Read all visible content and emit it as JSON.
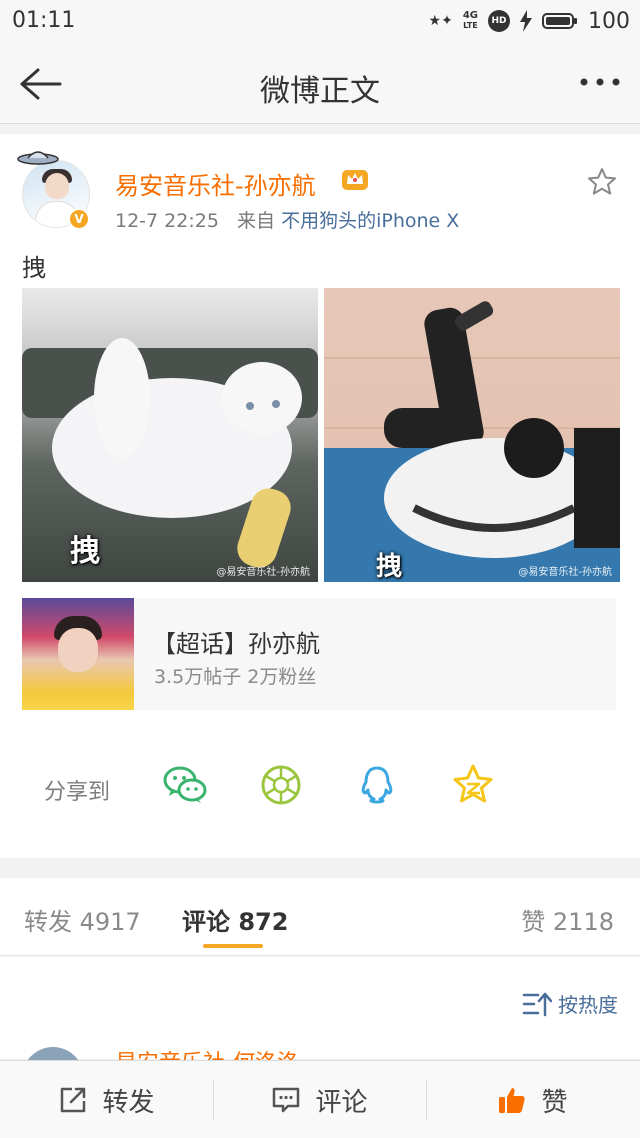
{
  "status_bar": {
    "time": "01:11",
    "network": "4G",
    "network_sub": "LTE",
    "hd": "HD",
    "battery": "100"
  },
  "nav": {
    "title": "微博正文",
    "back_icon": "arrow-left-icon",
    "more_icon": "more-dots-icon"
  },
  "post": {
    "username": "易安音乐社-孙亦航",
    "verified_badge": "V",
    "time": "12-7 22:25",
    "source_prefix": "来自",
    "source": "不用狗头的iPhone X",
    "text": "拽",
    "images": [
      {
        "caption": "拽",
        "watermark": "@易安音乐社-孙亦航"
      },
      {
        "caption": "拽",
        "watermark": "@易安音乐社-孙亦航"
      }
    ]
  },
  "super_topic": {
    "name": "【超话】孙亦航",
    "stats": "3.5万帖子  2万粉丝"
  },
  "share": {
    "label": "分享到",
    "targets": [
      "wechat-icon",
      "moments-icon",
      "qq-icon",
      "qzone-icon"
    ]
  },
  "tabs": {
    "repost": "转发 4917",
    "comment": "评论 872",
    "like": "赞 2118"
  },
  "sort": {
    "label": "按热度"
  },
  "next_comment": {
    "username": "易安音乐社-何洛洛"
  },
  "bottom_bar": {
    "repost": "转发",
    "comment": "评论",
    "like": "赞"
  },
  "colors": {
    "username": "#f86e00",
    "link": "#4a6e9a",
    "accent": "#f5a623",
    "wechat": "#38b46c",
    "qq": "#3aa7e0",
    "qzone": "#f5c518"
  }
}
